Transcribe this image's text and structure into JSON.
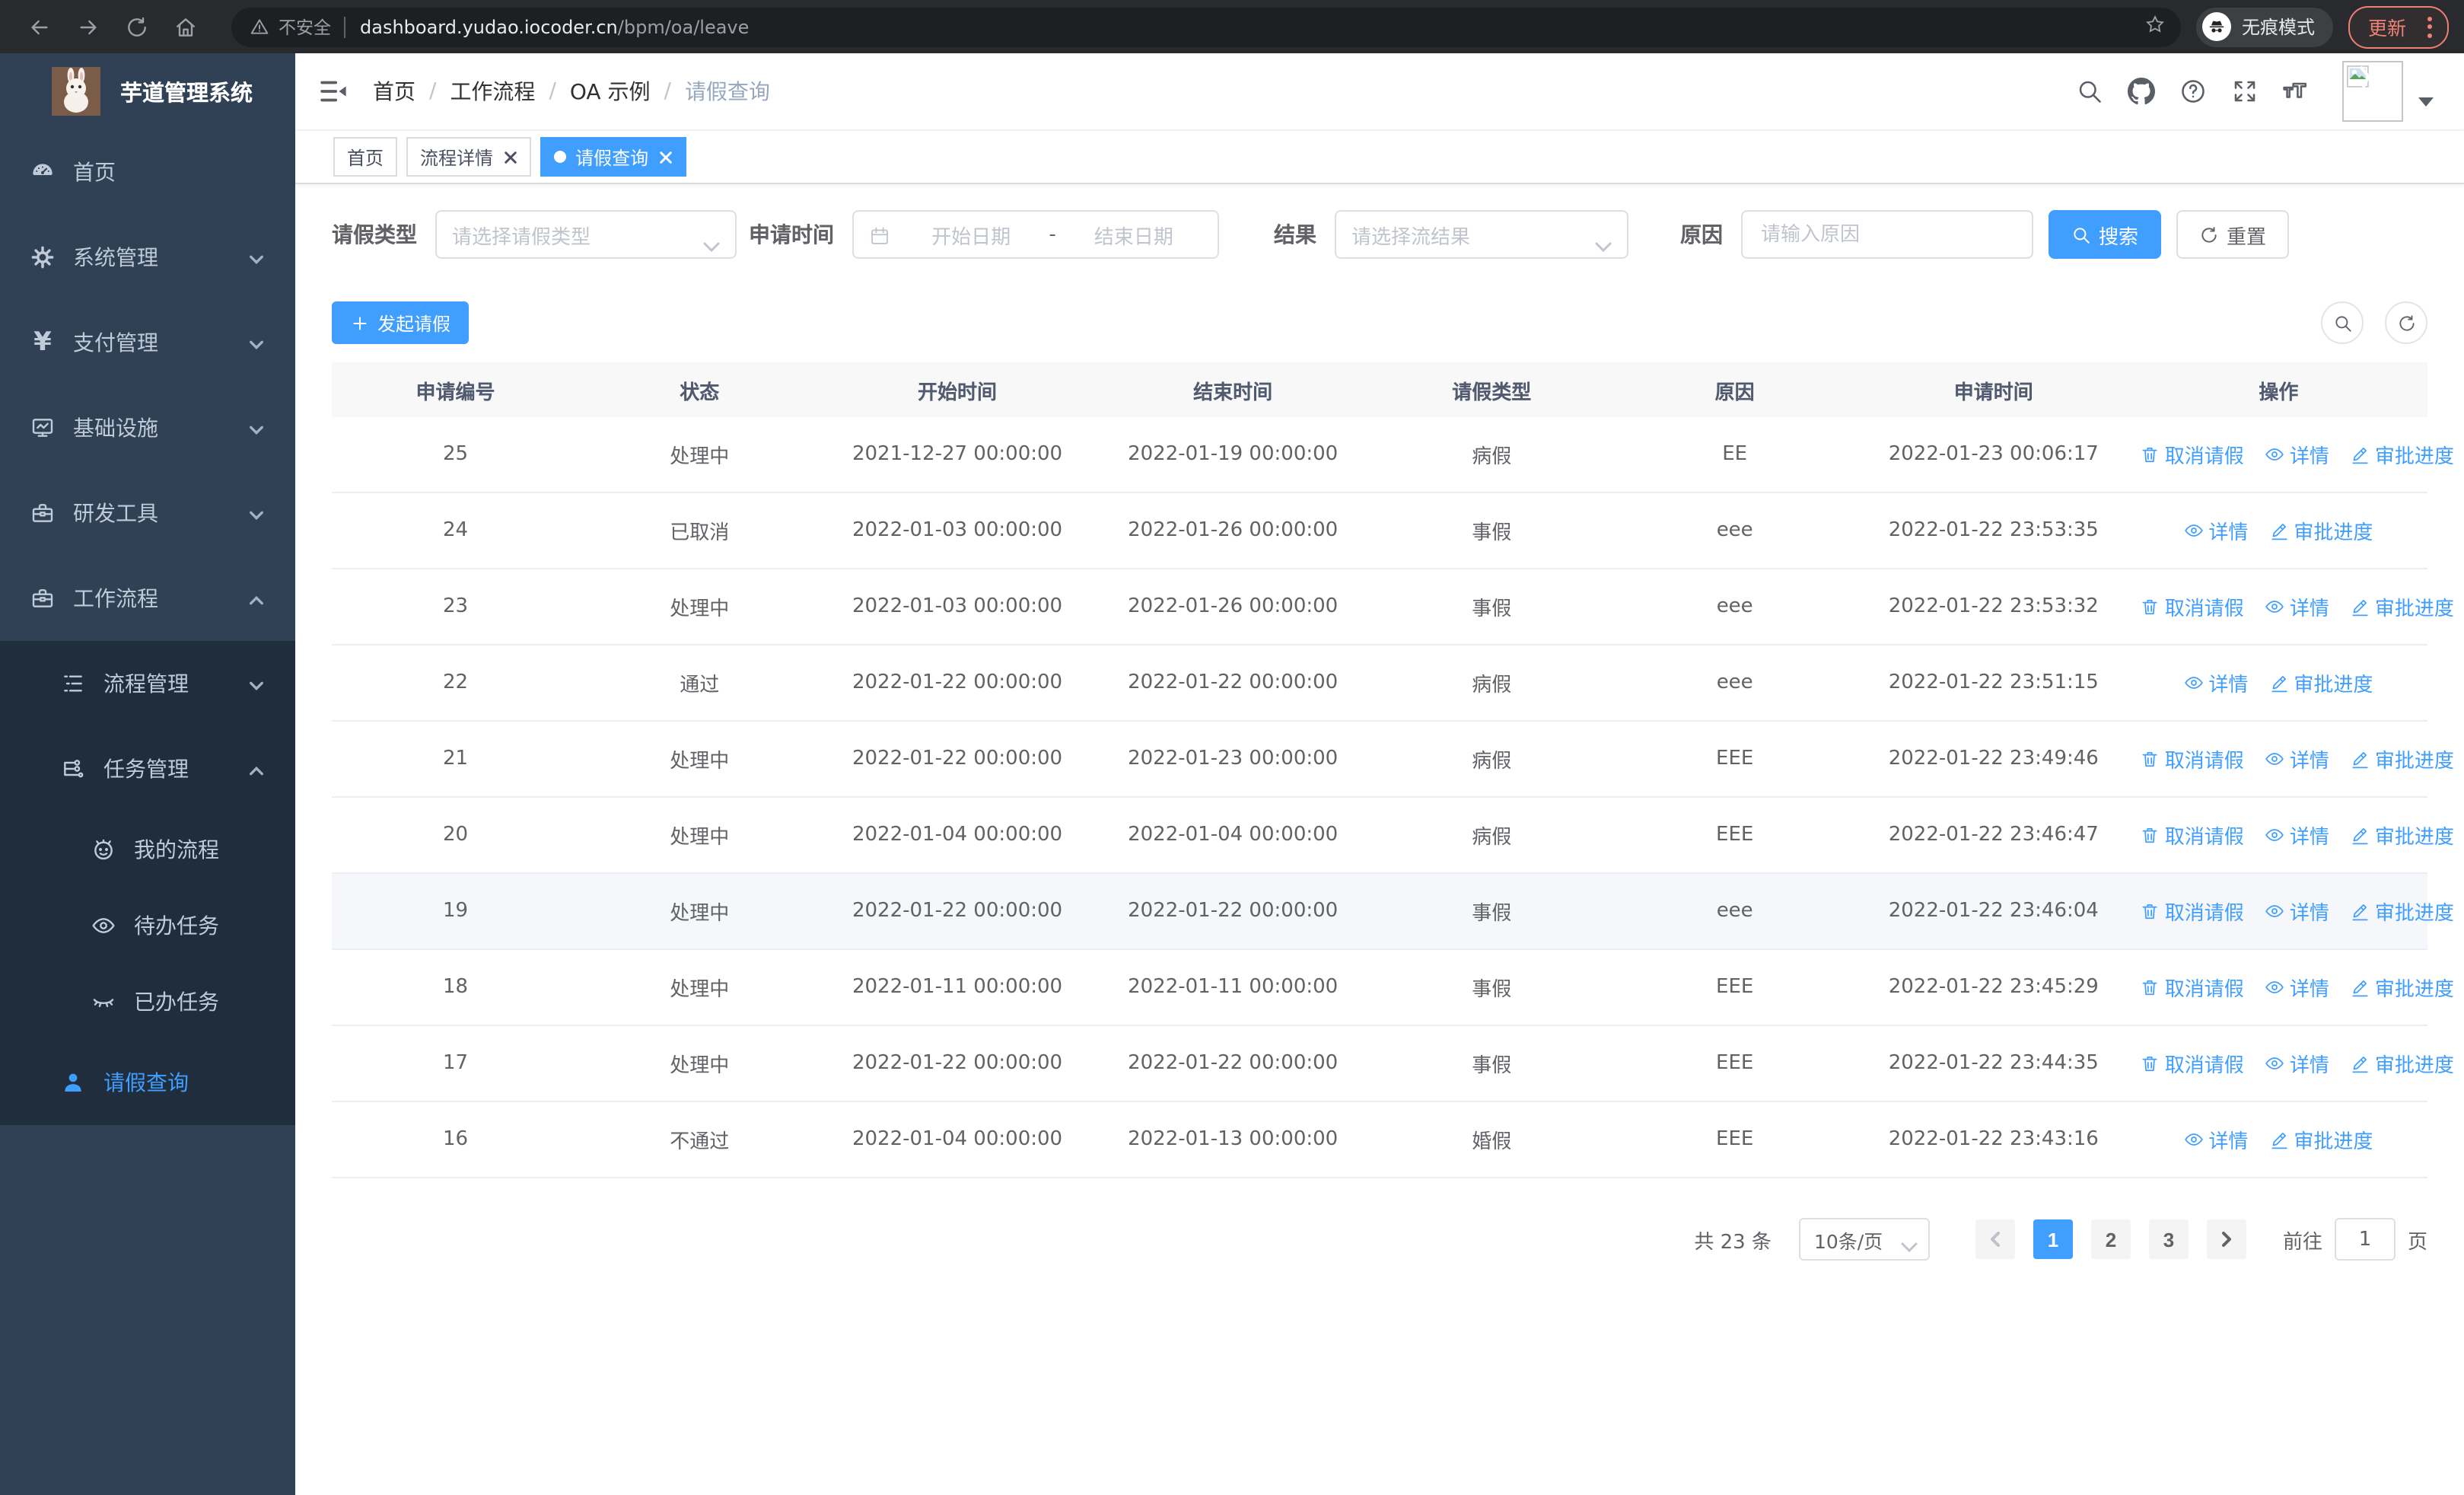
{
  "browser": {
    "security_label": "不安全",
    "url_host": "dashboard.yudao.iocoder.cn",
    "url_path": "/bpm/oa/leave",
    "incognito_label": "无痕模式",
    "update_label": "更新",
    "icons": [
      "back-icon",
      "forward-icon",
      "reload-icon",
      "home-icon",
      "warning-icon",
      "star-icon",
      "incognito-icon",
      "more-vert-icon"
    ]
  },
  "sidebar": {
    "title": "芋道管理系统",
    "items": [
      {
        "label": "首页",
        "icon": "dashboard-icon"
      },
      {
        "label": "系统管理",
        "icon": "gear-icon",
        "state": "collapsed"
      },
      {
        "label": "支付管理",
        "icon": "yen-icon",
        "state": "collapsed"
      },
      {
        "label": "基础设施",
        "icon": "monitor-icon",
        "state": "collapsed"
      },
      {
        "label": "研发工具",
        "icon": "toolbox-icon",
        "state": "collapsed"
      },
      {
        "label": "工作流程",
        "icon": "briefcase-icon",
        "state": "expanded"
      }
    ],
    "submenu": {
      "process_mgmt": "流程管理",
      "task_mgmt": "任务管理",
      "my_process": "我的流程",
      "todo_tasks": "待办任务",
      "done_tasks": "已办任务",
      "leave_query": "请假查询"
    }
  },
  "header": {
    "breadcrumb": [
      "首页",
      "工作流程",
      "OA 示例",
      "请假查询"
    ],
    "icons": [
      "search-icon",
      "github-icon",
      "help-icon",
      "fullscreen-icon",
      "font-size-icon",
      "avatar-broken-image",
      "caret-down-icon"
    ]
  },
  "tabs": {
    "home": "首页",
    "process_detail": "流程详情",
    "leave_query": "请假查询"
  },
  "filters": {
    "leave_type_label": "请假类型",
    "leave_type_placeholder": "请选择请假类型",
    "apply_time_label": "申请时间",
    "start_date_placeholder": "开始日期",
    "date_separator": "-",
    "end_date_placeholder": "结束日期",
    "result_label": "结果",
    "result_placeholder": "请选择流结果",
    "reason_label": "原因",
    "reason_placeholder": "请输入原因",
    "search_label": "搜索",
    "reset_label": "重置"
  },
  "toolbar": {
    "create_label": "发起请假"
  },
  "table": {
    "columns": [
      "申请编号",
      "状态",
      "开始时间",
      "结束时间",
      "请假类型",
      "原因",
      "申请时间",
      "操作"
    ],
    "actions": {
      "cancel": "取消请假",
      "detail": "详情",
      "progress": "审批进度"
    },
    "rows": [
      {
        "id": "25",
        "status": "处理中",
        "start": "2021-12-27 00:00:00",
        "end": "2022-01-19 00:00:00",
        "type": "病假",
        "reason": "EE",
        "applied": "2022-01-23 00:06:17",
        "can_cancel": true,
        "highlighted": false
      },
      {
        "id": "24",
        "status": "已取消",
        "start": "2022-01-03 00:00:00",
        "end": "2022-01-26 00:00:00",
        "type": "事假",
        "reason": "eee",
        "applied": "2022-01-22 23:53:35",
        "can_cancel": false,
        "highlighted": false
      },
      {
        "id": "23",
        "status": "处理中",
        "start": "2022-01-03 00:00:00",
        "end": "2022-01-26 00:00:00",
        "type": "事假",
        "reason": "eee",
        "applied": "2022-01-22 23:53:32",
        "can_cancel": true,
        "highlighted": false
      },
      {
        "id": "22",
        "status": "通过",
        "start": "2022-01-22 00:00:00",
        "end": "2022-01-22 00:00:00",
        "type": "病假",
        "reason": "eee",
        "applied": "2022-01-22 23:51:15",
        "can_cancel": false,
        "highlighted": false
      },
      {
        "id": "21",
        "status": "处理中",
        "start": "2022-01-22 00:00:00",
        "end": "2022-01-23 00:00:00",
        "type": "病假",
        "reason": "EEE",
        "applied": "2022-01-22 23:49:46",
        "can_cancel": true,
        "highlighted": false
      },
      {
        "id": "20",
        "status": "处理中",
        "start": "2022-01-04 00:00:00",
        "end": "2022-01-04 00:00:00",
        "type": "病假",
        "reason": "EEE",
        "applied": "2022-01-22 23:46:47",
        "can_cancel": true,
        "highlighted": false
      },
      {
        "id": "19",
        "status": "处理中",
        "start": "2022-01-22 00:00:00",
        "end": "2022-01-22 00:00:00",
        "type": "事假",
        "reason": "eee",
        "applied": "2022-01-22 23:46:04",
        "can_cancel": true,
        "highlighted": true
      },
      {
        "id": "18",
        "status": "处理中",
        "start": "2022-01-11 00:00:00",
        "end": "2022-01-11 00:00:00",
        "type": "事假",
        "reason": "EEE",
        "applied": "2022-01-22 23:45:29",
        "can_cancel": true,
        "highlighted": false
      },
      {
        "id": "17",
        "status": "处理中",
        "start": "2022-01-22 00:00:00",
        "end": "2022-01-22 00:00:00",
        "type": "事假",
        "reason": "EEE",
        "applied": "2022-01-22 23:44:35",
        "can_cancel": true,
        "highlighted": false
      },
      {
        "id": "16",
        "status": "不通过",
        "start": "2022-01-04 00:00:00",
        "end": "2022-01-13 00:00:00",
        "type": "婚假",
        "reason": "EEE",
        "applied": "2022-01-22 23:43:16",
        "can_cancel": false,
        "highlighted": false
      }
    ]
  },
  "pagination": {
    "total_label": "共 23 条",
    "page_size": "10条/页",
    "pages": [
      "1",
      "2",
      "3"
    ],
    "current_page": "1",
    "goto_label": "前往",
    "goto_value": "1",
    "page_unit": "页"
  },
  "colors": {
    "primary": "#409eff",
    "sidebar_bg": "#304156",
    "submenu_bg": "#1f2d3d",
    "sidebar_text": "#bfcbd9",
    "update_accent": "#ee8277",
    "table_header_bg": "#f8f8f9"
  }
}
